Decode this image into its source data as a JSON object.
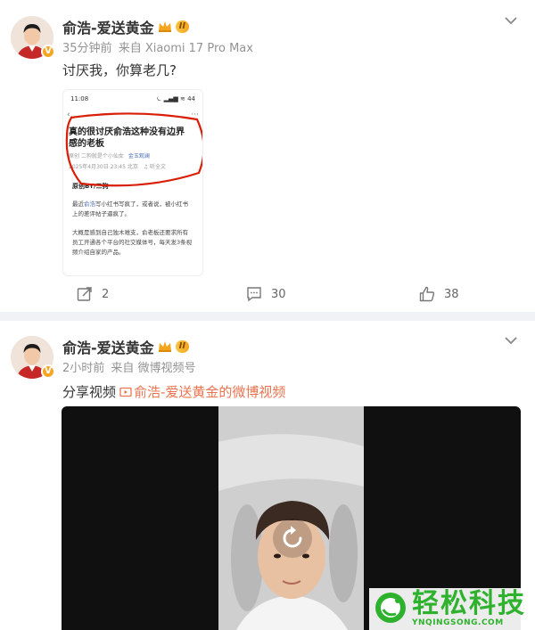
{
  "colors": {
    "accent_orange": "#eb7350",
    "meta_gray": "#939393",
    "link_blue": "#4a6fb5",
    "watermark_green": "#2eb22e"
  },
  "posts": [
    {
      "author": "俞浩-爱送黄金",
      "level_badge": "II",
      "verified": "V",
      "time": "35分钟前",
      "source": "来自 Xiaomi 17 Pro Max",
      "text": "讨厌我，你算老几?",
      "embedded_image": {
        "status_time": "11:08",
        "status_icons": "⏾ ▂▄▆ ≋ 44",
        "back": "‹",
        "more": "···",
        "title": "真的很讨厌俞浩这种没有边界感的老板",
        "author_line": "原创  二狗就是个小仙女",
        "author_link": "金玉观澜",
        "date_line": "2025年4月30日 23:45  北京",
        "listen": "♫ 听全文",
        "original_by": "原创BY/二狗",
        "body_1a": "最近",
        "body_1link": "俞浩",
        "body_1b": "写小红书写疯了，或者说，被小红书上的差评帖子逼疯了。",
        "body_2": "大概是感到自己独木难支，俞老板还要求所有员工开通各个平台的社交媒体号，每天发3条视频介绍自家的产品。"
      },
      "actions": {
        "repost_count": "2",
        "comment_count": "30",
        "like_count": "38"
      }
    },
    {
      "author": "俞浩-爱送黄金",
      "level_badge": "II",
      "verified": "V",
      "time": "2小时前",
      "source": "来自 微博视频号",
      "share_label": "分享视频",
      "share_link": "俞浩-爱送黄金的微博视频"
    }
  ],
  "watermark": {
    "text": "轻松科技",
    "sub": "YNQINGSONG.COM"
  }
}
